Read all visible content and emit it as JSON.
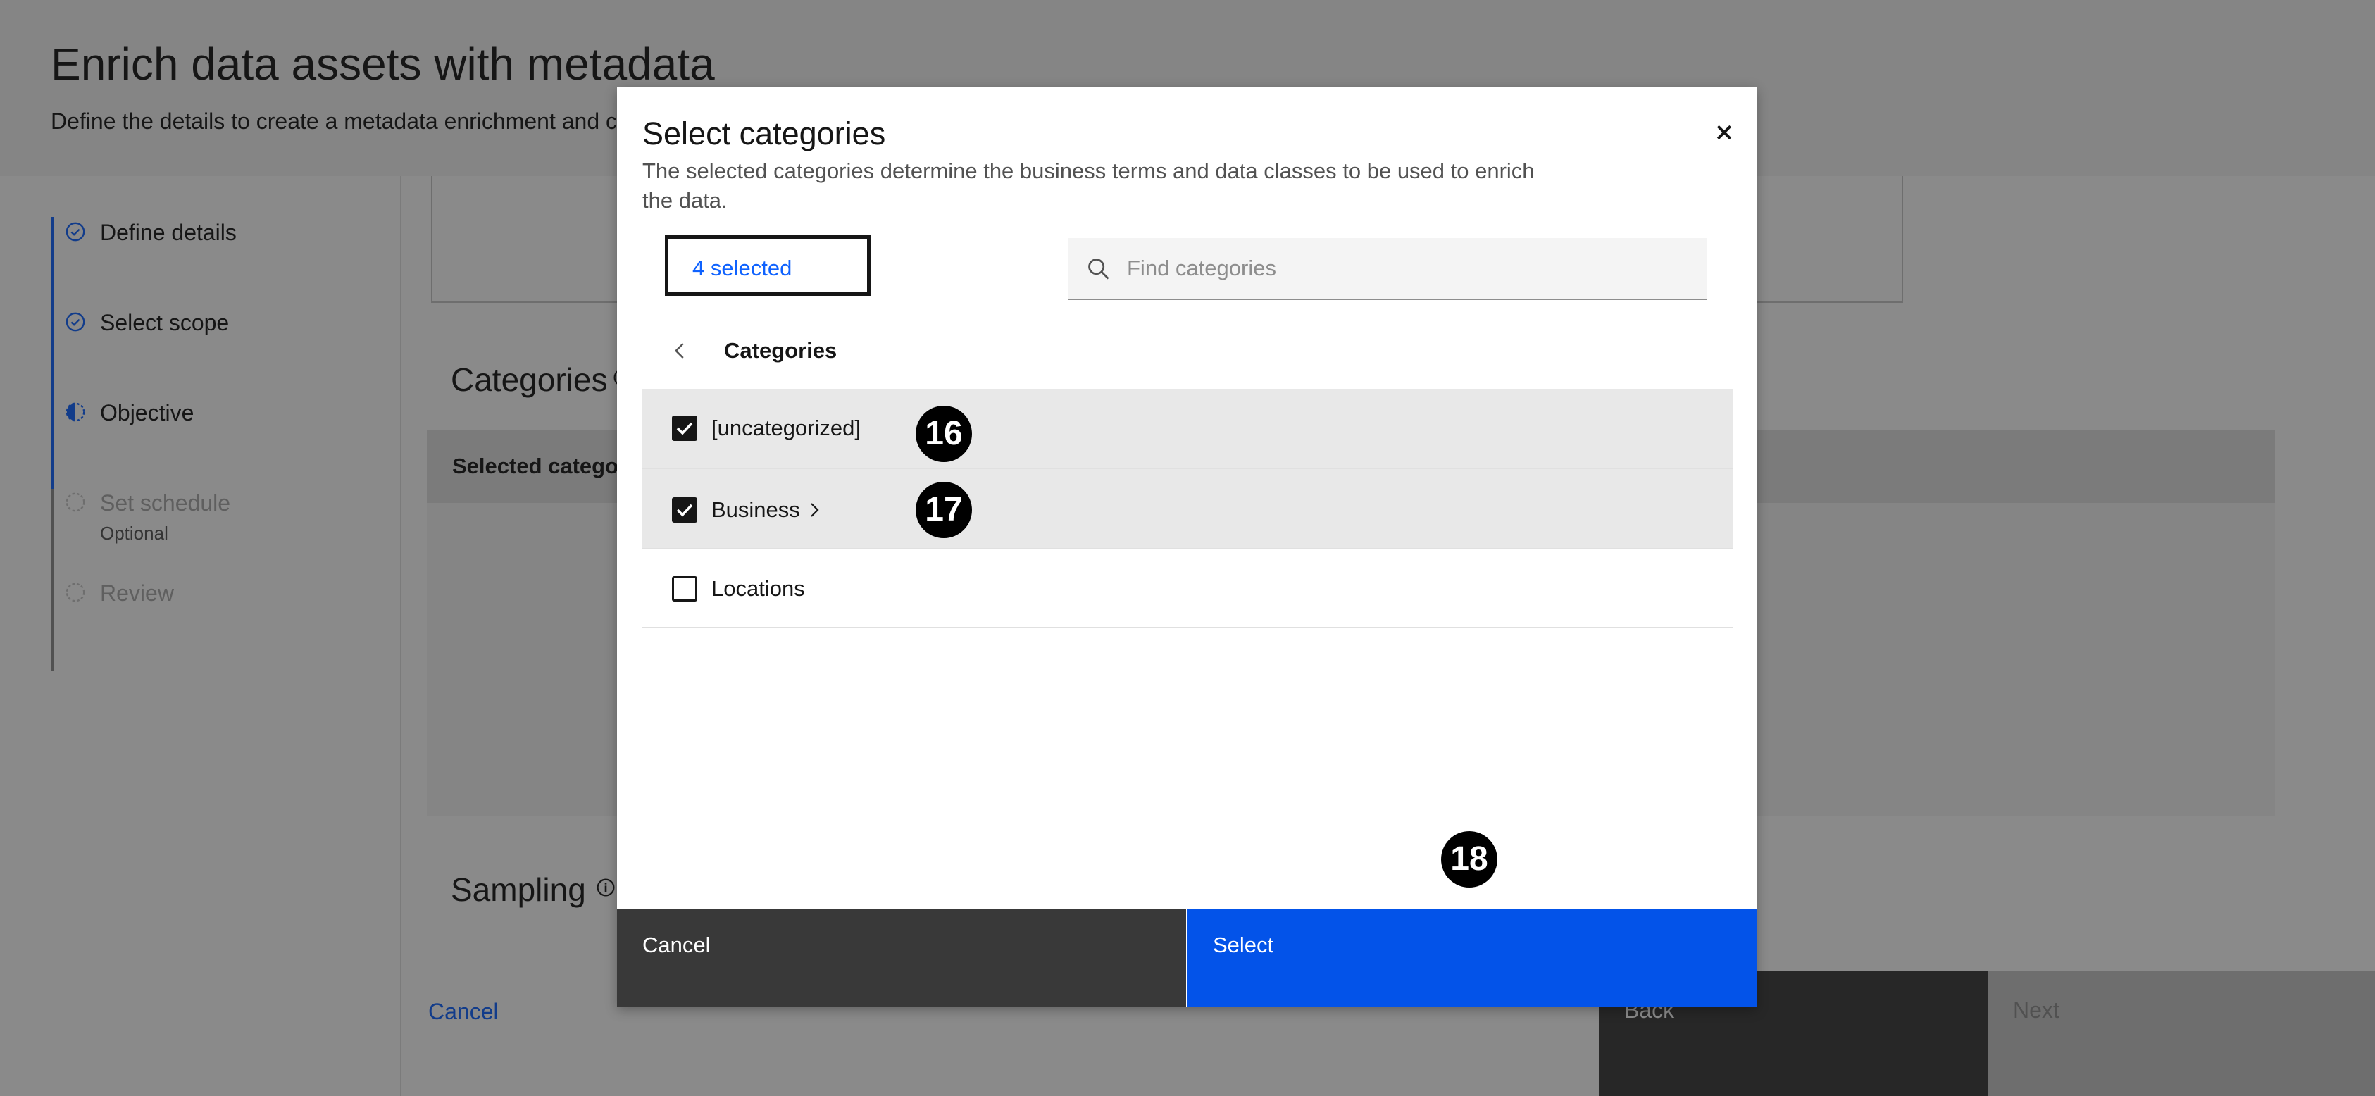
{
  "page": {
    "title": "Enrich data assets with metadata",
    "description": "Define the details to create a metadata enrichment and c"
  },
  "steps": [
    {
      "label": "Define details",
      "status": "complete",
      "icon": "checkmark-outline-icon"
    },
    {
      "label": "Select scope",
      "status": "complete",
      "icon": "checkmark-outline-icon"
    },
    {
      "label": "Objective",
      "status": "current",
      "icon": "incomplete-half-icon"
    },
    {
      "label": "Set schedule",
      "sublabel": "Optional",
      "status": "disabled",
      "icon": "dashed-circle-icon"
    },
    {
      "label": "Review",
      "status": "disabled",
      "icon": "dashed-circle-icon"
    }
  ],
  "sections": {
    "categories_title": "Categories",
    "selected_categories_header": "Selected catego",
    "sampling_title": "Sampling"
  },
  "footer": {
    "cancel_label": "Cancel",
    "back_label": "Back",
    "next_label": "Next"
  },
  "modal": {
    "title": "Select categories",
    "description": "The selected categories determine the business terms and data classes to be used to enrich the data.",
    "selected_count_label": "4 selected",
    "search_placeholder": "Find categories",
    "breadcrumb_title": "Categories",
    "rows": [
      {
        "label": "[uncategorized]",
        "checked": true,
        "has_children": false
      },
      {
        "label": "Business",
        "checked": true,
        "has_children": true
      },
      {
        "label": "Locations",
        "checked": false,
        "has_children": false
      }
    ],
    "cancel_label": "Cancel",
    "select_label": "Select"
  },
  "annotations": {
    "badge_16": "16",
    "badge_17": "17",
    "badge_18": "18"
  },
  "colors": {
    "primary_blue": "#0f62fe",
    "select_button": "#0353e9",
    "dark_button": "#393939",
    "overlay": "rgba(22,22,22,0.5)"
  }
}
